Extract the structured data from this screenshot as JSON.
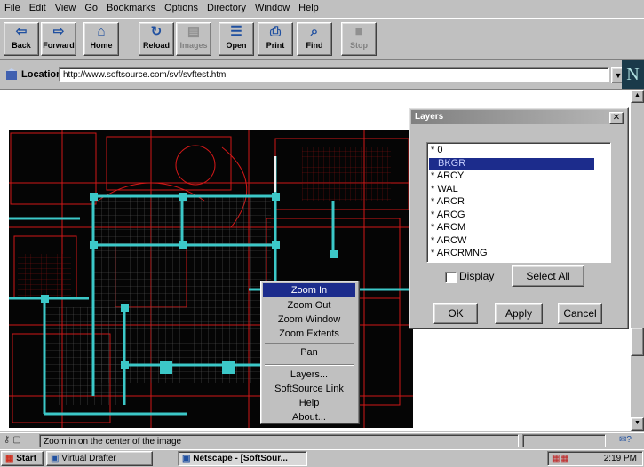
{
  "menu": [
    "File",
    "Edit",
    "View",
    "Go",
    "Bookmarks",
    "Options",
    "Directory",
    "Window",
    "Help"
  ],
  "toolbar": [
    {
      "label": "Back",
      "icon": "back-arrow-icon",
      "glyph": "⇦",
      "enabled": true
    },
    {
      "label": "Forward",
      "icon": "forward-arrow-icon",
      "glyph": "⇨",
      "enabled": true
    },
    {
      "label": "Home",
      "icon": "home-icon",
      "glyph": "⌂",
      "enabled": true
    },
    {
      "label": "Reload",
      "icon": "reload-icon",
      "glyph": "↻",
      "enabled": true
    },
    {
      "label": "Images",
      "icon": "images-icon",
      "glyph": "▤",
      "enabled": false
    },
    {
      "label": "Open",
      "icon": "open-icon",
      "glyph": "☰",
      "enabled": true
    },
    {
      "label": "Print",
      "icon": "print-icon",
      "glyph": "⎙",
      "enabled": true
    },
    {
      "label": "Find",
      "icon": "find-icon",
      "glyph": "⌕",
      "enabled": true
    },
    {
      "label": "Stop",
      "icon": "stop-icon",
      "glyph": "■",
      "enabled": false
    }
  ],
  "location": {
    "label": "Location:",
    "url": "http://www.softsource.com/svf/svftest.html"
  },
  "brand_logo": "N",
  "context_menu": {
    "items": [
      "Zoom In",
      "Zoom Out",
      "Zoom Window",
      "Zoom Extents",
      "Pan",
      "Layers...",
      "SoftSource Link",
      "Help",
      "About..."
    ],
    "selected": "Zoom In"
  },
  "layers_dialog": {
    "title": "Layers",
    "layers": [
      "* 0",
      "BKGR",
      "* ARCY",
      "* WAL",
      "* ARCR",
      "* ARCG",
      "* ARCM",
      "* ARCW",
      "* ARCRMNG"
    ],
    "selected": "BKGR",
    "display_label": "Display",
    "display_checked": false,
    "select_all": "Select All",
    "ok": "OK",
    "apply": "Apply",
    "cancel": "Cancel"
  },
  "status_text": "Zoom in on the center of the image",
  "taskbar": {
    "start": "Start",
    "tasks": [
      "Virtual Drafter",
      "Netscape - [SoftSour..."
    ],
    "active_task": "Netscape - [SoftSour...",
    "clock": "2:19 PM"
  },
  "colors": {
    "selection": "#1c2c8c",
    "cad_background": "#050505",
    "cad_lines": "#d01818",
    "cad_walls": "#3cc8c8"
  }
}
